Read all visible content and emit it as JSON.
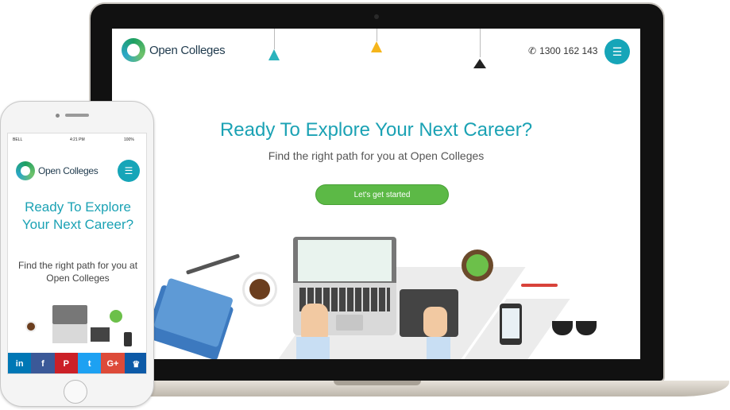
{
  "laptop_site": {
    "logo_text": "Open Colleges",
    "phone_number": "1300 162 143",
    "title": "Ready To Explore Your Next Career?",
    "subtitle": "Find the right path for you at Open Colleges",
    "cta_label": "Let's get started"
  },
  "phone_site": {
    "status": {
      "carrier": "BELL",
      "time": "4:21 PM",
      "battery": "100%"
    },
    "logo_text": "Open Colleges",
    "title": "Ready To Explore Your Next Career?",
    "subtitle": "Find the right path for you at Open Colleges",
    "social_buttons": [
      {
        "icon": "linkedin-icon",
        "label": "in",
        "color": "#0077b5"
      },
      {
        "icon": "facebook-icon",
        "label": "f",
        "color": "#3b5998"
      },
      {
        "icon": "pinterest-icon",
        "label": "P",
        "color": "#cb2027"
      },
      {
        "icon": "twitter-icon",
        "label": "t",
        "color": "#1da1f2"
      },
      {
        "icon": "googleplus-icon",
        "label": "G+",
        "color": "#dd4b39"
      },
      {
        "icon": "crown-icon",
        "label": "♛",
        "color": "#0d5aa7"
      }
    ]
  },
  "colors": {
    "accent_teal": "#1ba2b4",
    "button_green": "#5cb946",
    "hamburger_teal": "#16a5b8"
  }
}
